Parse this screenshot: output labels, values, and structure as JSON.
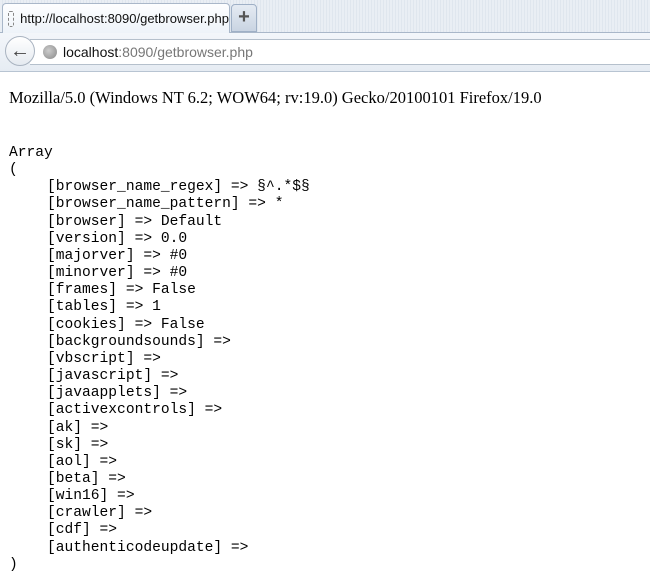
{
  "tab": {
    "title": "http://localhost:8090/getbrowser.php",
    "new_tab": "+"
  },
  "nav": {
    "back": "←",
    "url_host": "localhost",
    "url_rest": ":8090/getbrowser.php"
  },
  "user_agent": "Mozilla/5.0 (Windows NT 6.2; WOW64; rv:19.0) Gecko/20100101 Firefox/19.0",
  "dump": {
    "open1": "Array",
    "open2": "(",
    "close": ")",
    "items": [
      "[browser_name_regex] => §^.*$§",
      "[browser_name_pattern] => *",
      "[browser] => Default",
      "[version] => 0.0",
      "[majorver] => #0",
      "[minorver] => #0",
      "[frames] => False",
      "[tables] => 1",
      "[cookies] => False",
      "[backgroundsounds] =>",
      "[vbscript] =>",
      "[javascript] =>",
      "[javaapplets] =>",
      "[activexcontrols] =>",
      "[ak] =>",
      "[sk] =>",
      "[aol] =>",
      "[beta] =>",
      "[win16] =>",
      "[crawler] =>",
      "[cdf] =>",
      "[authenticodeupdate] =>"
    ]
  }
}
